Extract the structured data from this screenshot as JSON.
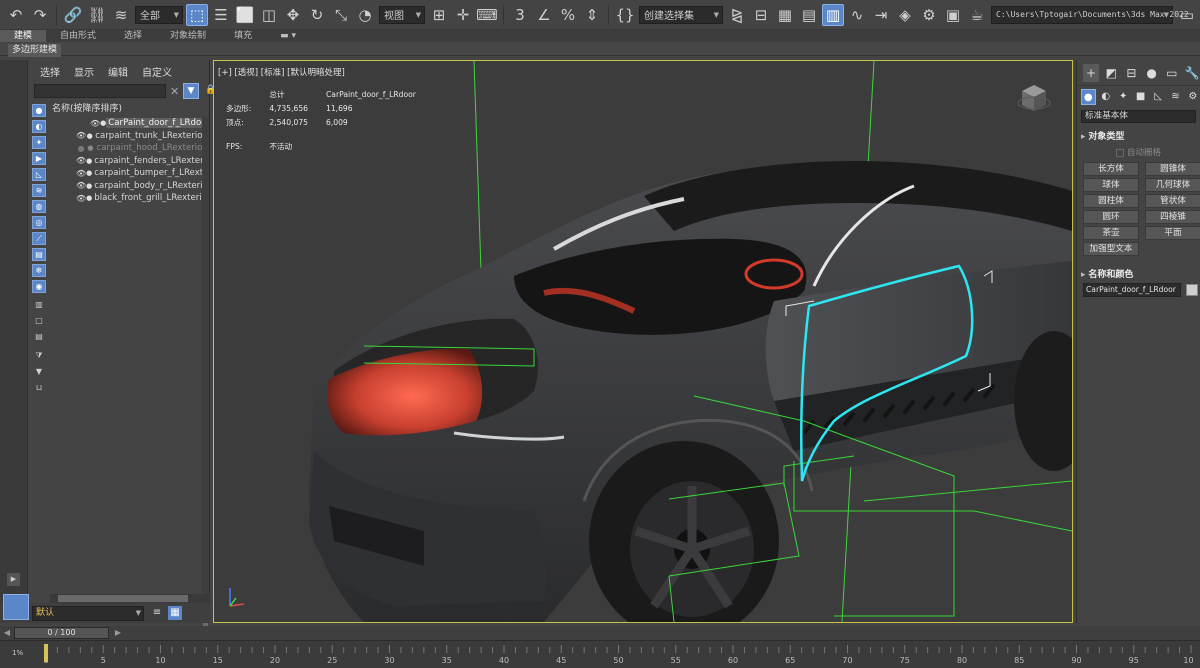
{
  "toolbar": {
    "filter_combo": "全部",
    "refcoord_combo": "视图",
    "selection_set_combo": "创建选择集",
    "path_combo": "C:\\Users\\Tptogair\\Documents\\3ds Max 2022"
  },
  "ribbon": {
    "tabs": [
      "建模",
      "自由形式",
      "选择",
      "对象绘制",
      "填充"
    ],
    "active_tab": "建模",
    "sub_label": "多边形建模"
  },
  "explorer": {
    "menu": [
      "选择",
      "显示",
      "编辑",
      "自定义"
    ],
    "header": "名称(按降序排序)",
    "items": [
      {
        "name": "CarPaint_door_f_LRdoor",
        "selected": true,
        "hidden": false
      },
      {
        "name": "carpaint_trunk_LRexterior",
        "selected": false,
        "hidden": false
      },
      {
        "name": "carpaint_hood_LRexterior",
        "selected": false,
        "hidden": true
      },
      {
        "name": "carpaint_fenders_LRexterior",
        "selected": false,
        "hidden": false
      },
      {
        "name": "carpaint_bumper_f_LRexterior",
        "selected": false,
        "hidden": false
      },
      {
        "name": "carpaint_body_r_LRexterior",
        "selected": false,
        "hidden": false
      },
      {
        "name": "black_front_grill_LRexterior",
        "selected": false,
        "hidden": false
      }
    ],
    "layer": "默认"
  },
  "viewport": {
    "label": "[+] [透视] [标准] [默认明暗处理]",
    "stats": {
      "col_total": "总计",
      "col_selected": "CarPaint_door_f_LRdoor",
      "polys_label": "多边形:",
      "polys_total": "4,735,656",
      "polys_selected": "11,696",
      "verts_label": "顶点:",
      "verts_total": "2,540,075",
      "verts_selected": "6,009",
      "fps_label": "FPS:",
      "fps_value": "不活动"
    },
    "axis_labels": {
      "y": "y",
      "z": "z",
      "x": "x"
    }
  },
  "command_panel": {
    "category_combo": "标准基本体",
    "rollout_object_type": "对象类型",
    "autogrid": "自动栅格",
    "object_buttons": [
      "长方体",
      "圆锥体",
      "球体",
      "几何球体",
      "圆柱体",
      "管状体",
      "圆环",
      "四棱锥",
      "茶壶",
      "平面",
      "加强型文本"
    ],
    "rollout_name_color": "名称和颜色",
    "object_name": "CarPaint_door_f_LRdoor"
  },
  "timeline": {
    "frame_display": "0 / 100",
    "ticks": [
      "0",
      "5",
      "10",
      "15",
      "20",
      "25",
      "30",
      "35",
      "40",
      "45",
      "50",
      "55",
      "60",
      "65",
      "70",
      "75",
      "80",
      "85",
      "90",
      "95",
      "100"
    ],
    "left_label": "1%"
  },
  "colors": {
    "accent": "#5b87c9",
    "viewport_border": "#c9c34a",
    "selection_wire": "#2ee6f0",
    "bbox_wire": "#39d63a",
    "layer_text": "#e3c25e"
  }
}
